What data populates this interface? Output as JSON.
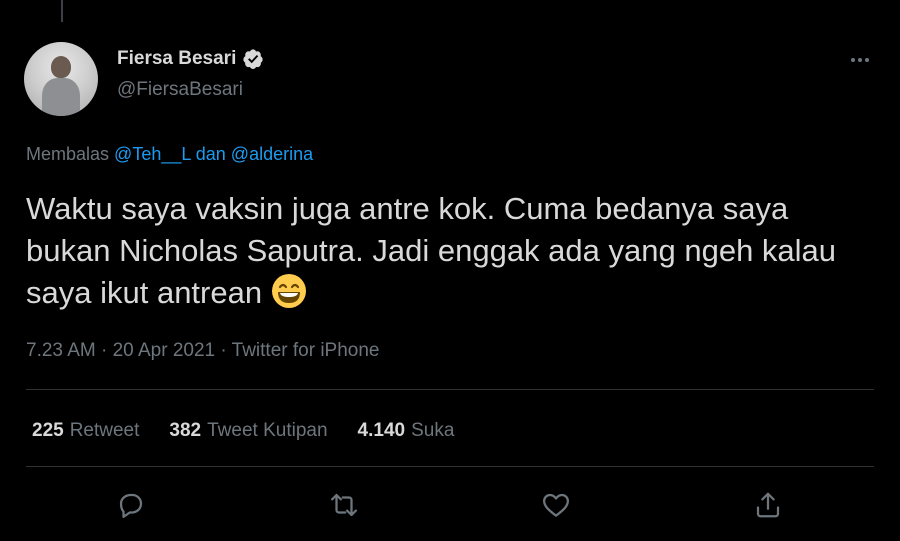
{
  "author": {
    "name": "Fiersa Besari",
    "handle": "@FiersaBesari",
    "verified": true
  },
  "reply": {
    "prefix": "Membalas",
    "mention1": "@Teh__L",
    "joiner": "dan",
    "mention2": "@alderina"
  },
  "tweet": {
    "text": "Waktu saya vaksin juga antre kok. Cuma bedanya saya bukan Nicholas Saputra. Jadi enggak ada yang ngeh kalau saya ikut antrean",
    "emoji": "grinning-face-with-smiling-eyes"
  },
  "meta": {
    "time": "7.23 AM",
    "date": "20 Apr 2021",
    "source": "Twitter for iPhone"
  },
  "stats": {
    "retweets": "225",
    "retweets_label": "Retweet",
    "quotes": "382",
    "quotes_label": "Tweet Kutipan",
    "likes": "4.140",
    "likes_label": "Suka"
  },
  "actions": [
    "reply-icon",
    "retweet-icon",
    "like-icon",
    "share-icon"
  ],
  "colors": {
    "background": "#000000",
    "text": "#d9d9d9",
    "secondary": "#6e767d",
    "link": "#1d9bf0",
    "divider": "#2f3336"
  }
}
